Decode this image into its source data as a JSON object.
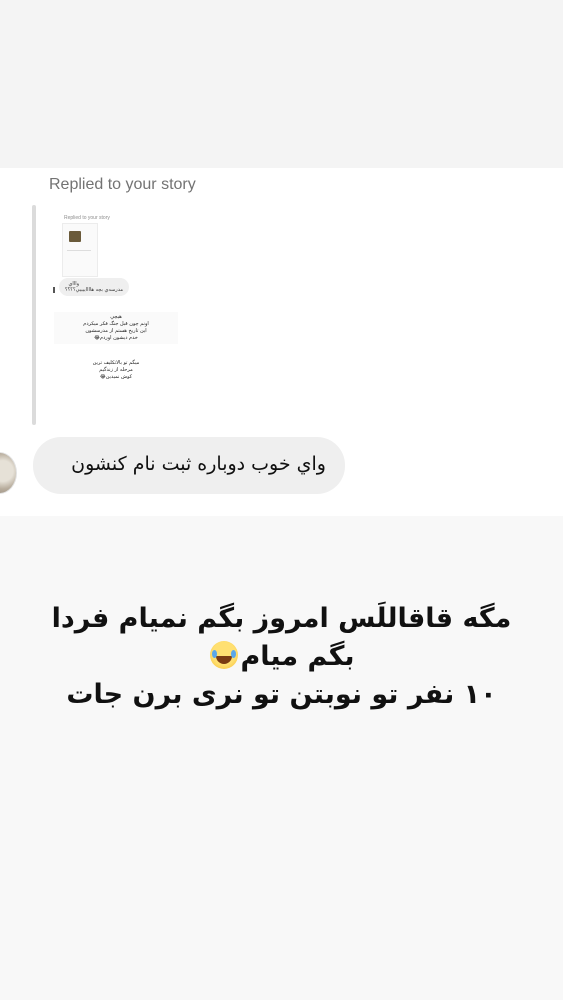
{
  "story_reply": {
    "header": "Replied to your story",
    "thumbnail": {
      "header": "Replied to your story",
      "bubble_line1": "واااي",
      "bubble_line2": "مدرسه‌ي بچه هااااييييي؟؟؟؟",
      "message1": "هيچي\nاونم چون قبل جنگ فكر ميكردم\nاين تاريخ هستم از مدرسشون\nخدم دیشون اوردم😂",
      "message2": "ميگم تو بالاتكليف ترين\nمرحله از زندگيم\nكوش نميدين😂"
    },
    "reply_message": "واي خوب دوباره ثبت نام كنشون"
  },
  "story_text": {
    "line1": "مگه قاقاللَس امروز بگم نمیام فردا",
    "line2": "بگم میام",
    "line2_emoji": "face-with-tears-of-joy",
    "line3": "۱۰ نفر تو نوبتن تو نری برن جات"
  }
}
